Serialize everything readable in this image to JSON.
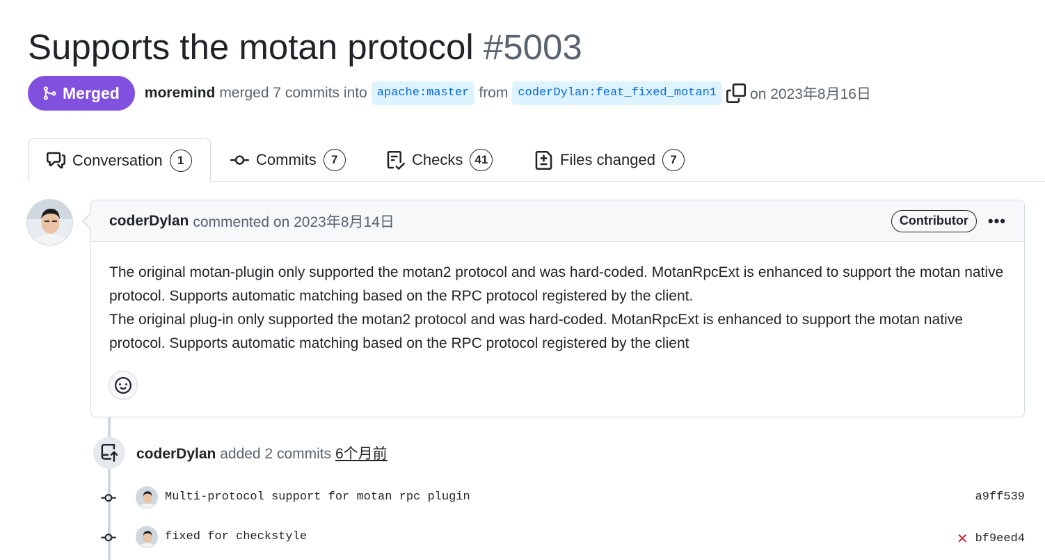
{
  "pr": {
    "title": "Supports the motan protocol",
    "number": "#5003",
    "state_label": "Merged",
    "merged_by": "moremind",
    "merge_text": "merged 7 commits into",
    "base_branch": "apache:master",
    "from_text": "from",
    "head_branch": "coderDylan:feat_fixed_motan1",
    "merge_date": "on 2023年8月16日"
  },
  "tabs": [
    {
      "label": "Conversation",
      "count": "1"
    },
    {
      "label": "Commits",
      "count": "7"
    },
    {
      "label": "Checks",
      "count": "41"
    },
    {
      "label": "Files changed",
      "count": "7"
    }
  ],
  "comment": {
    "author": "coderDylan",
    "meta": "commented on 2023年8月14日",
    "role": "Contributor",
    "more": "•••",
    "paragraph1": "The original motan-plugin only supported the motan2 protocol and was hard-coded. MotanRpcExt is enhanced to support the motan native protocol. Supports automatic matching based on the RPC protocol registered by the client.",
    "paragraph2": "The original plug-in only supported the motan2 protocol and was hard-coded. MotanRpcExt is enhanced to support the motan native protocol. Supports automatic matching based on the RPC protocol registered by the client"
  },
  "event": {
    "author": "coderDylan",
    "text": "added 2 commits",
    "time": "6个月前"
  },
  "commits": [
    {
      "message": "Multi-protocol support for motan rpc plugin",
      "sha": "a9ff539",
      "status": ""
    },
    {
      "message": "fixed for checkstyle",
      "sha": "bf9eed4",
      "status": "✕"
    }
  ],
  "colors": {
    "merged": "#8250df",
    "branch_bg": "#ddf4ff",
    "branch_fg": "#0969da",
    "fail": "#d1242f",
    "border": "#d1d9e0"
  }
}
